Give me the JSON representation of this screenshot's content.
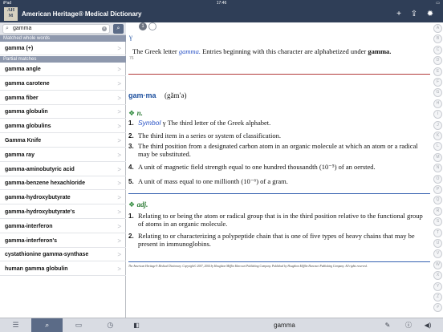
{
  "status": {
    "carrier": "iPad",
    "time": "17:46",
    "battery": "▭"
  },
  "app": {
    "title": "American Heritage® Medical Dictionary",
    "logo_top": "AH",
    "logo_bottom": "M"
  },
  "nav_icons": {
    "add": "+",
    "share": "⇪",
    "settings": "✹"
  },
  "search": {
    "query": "gamma",
    "search_glyph": "⌕",
    "clear_glyph": "×",
    "button_glyph": "⌕"
  },
  "sections": {
    "whole": "Matched whole words",
    "partial": "Partial matches"
  },
  "whole_matches": [
    {
      "label": "gamma (+)"
    }
  ],
  "partial_matches": [
    {
      "label": "gamma angle"
    },
    {
      "label": "gamma carotene"
    },
    {
      "label": "gamma fiber"
    },
    {
      "label": "gamma globulin"
    },
    {
      "label": "gamma globulins"
    },
    {
      "label": "Gamma Knife"
    },
    {
      "label": "gamma ray"
    },
    {
      "label": "gamma-aminobutyric acid"
    },
    {
      "label": "gamma-benzene hexachloride"
    },
    {
      "label": "gamma-hydroxybutyrate"
    },
    {
      "label": "gamma-hydroxybutyrate's"
    },
    {
      "label": "gamma-interferon"
    },
    {
      "label": "gamma-interferon's"
    },
    {
      "label": "cystathionine gamma-synthase"
    },
    {
      "label": "human gamma globulin"
    }
  ],
  "chevron": ">",
  "entry": {
    "pill_1": "1",
    "pill_2": "",
    "greek_head": "γ",
    "col_num": "76",
    "intro_a": "The Greek letter ",
    "intro_b": "gamma.",
    "intro_c": " Entries beginning with this character are alphabetized under ",
    "intro_d": "gamma.",
    "headword": "gam·ma",
    "pron": "(găm′ə)",
    "pos_marker": "❖",
    "noun_pos": "n.",
    "noun_defs": [
      {
        "num": "1.",
        "pre": "Symbol ",
        "post": "γ The third letter of the Greek alphabet."
      },
      {
        "num": "2.",
        "pre": "",
        "post": "The third item in a series or system of classification."
      },
      {
        "num": "3.",
        "pre": "",
        "post": "The third position from a designated carbon atom in an organic molecule at which an atom or a radical may be substituted."
      },
      {
        "num": "4.",
        "pre": "",
        "post": "A unit of magnetic field strength equal to one hundred thousandth (10⁻⁵) of an oersted."
      },
      {
        "num": "5.",
        "pre": "",
        "post": "A unit of mass equal to one millionth (10⁻⁶) of a gram."
      }
    ],
    "adj_pos": "adj.",
    "adj_defs": [
      {
        "num": "1.",
        "text": "Relating to or being the atom or radical group that is in the third position relative to the functional group of atoms in an organic molecule."
      },
      {
        "num": "2.",
        "text": "Relating to or characterizing a polypeptide chain that is one of five types of heavy chains that may be present in immunoglobins."
      }
    ],
    "copyright": "The American Heritage® Medical Dictionary. Copyright© 2007, 2004 by Houghton Mifflin Harcourt Publishing Company. Published by Houghton Mifflin Harcourt Publishing Company. All rights reserved."
  },
  "alpha_index": [
    "A",
    "B",
    "C",
    "D",
    "E",
    "F",
    "G",
    "H",
    "I",
    "J",
    "K",
    "L",
    "M",
    "N",
    "O",
    "P",
    "Q",
    "R",
    "S",
    "T",
    "U",
    "V",
    "W",
    "X",
    "Y",
    "Z",
    "#"
  ],
  "tabs": [
    {
      "name": "tab-list",
      "glyph": "☰"
    },
    {
      "name": "tab-search",
      "glyph": "⌕"
    },
    {
      "name": "tab-book",
      "glyph": "▭"
    },
    {
      "name": "tab-history",
      "glyph": "◷"
    }
  ],
  "toolbar": {
    "sidebar_glyph": "◧",
    "word": "gamma",
    "pen_glyph": "✎",
    "info_glyph": "ⓘ",
    "audio_glyph": "◀)"
  },
  "colors": {
    "nav": "#2f3e57",
    "section": "#8e98ad",
    "link": "#2b54c6",
    "pos_green": "#2b7a34",
    "rule_red": "#b23a3a",
    "rule_blue": "#3460b0"
  }
}
